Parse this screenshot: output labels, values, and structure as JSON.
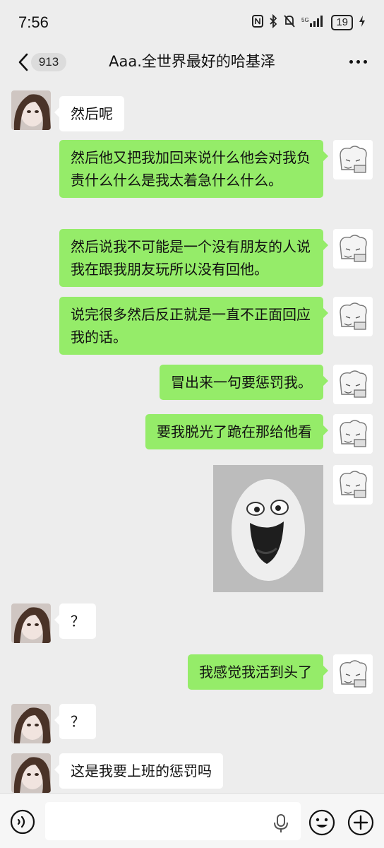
{
  "status": {
    "time": "7:56",
    "battery": "19",
    "network": "5G"
  },
  "nav": {
    "unread_count": "913",
    "title": "Aaa.全世界最好的哈基泽"
  },
  "messages": [
    {
      "side": "in",
      "text": "然后呢"
    },
    {
      "side": "out",
      "text": "然后他又把我加回来说什么他会对我负责什么什么是我太着急什么什么。"
    },
    {
      "side": "out",
      "text": "然后说我不可能是一个没有朋友的人说我在跟我朋友玩所以没有回他。"
    },
    {
      "side": "out",
      "text": "说完很多然后反正就是一直不正面回应我的话。"
    },
    {
      "side": "out",
      "text": "冒出来一句要惩罚我。"
    },
    {
      "side": "out",
      "text": "要我脱光了跪在那给他看"
    },
    {
      "side": "out",
      "type": "sticker",
      "sticker": "smiling-egg-face-sticker"
    },
    {
      "side": "in",
      "text": "？"
    },
    {
      "side": "out",
      "text": "我感觉我活到头了"
    },
    {
      "side": "in",
      "text": "？"
    },
    {
      "side": "in",
      "text": "这是我要上班的惩罚吗"
    }
  ],
  "input": {
    "placeholder": ""
  },
  "icons": {
    "back": "chevron-left-icon",
    "more": "more-dots-icon",
    "voice": "voice-icon",
    "mic": "microphone-icon",
    "emoji": "emoji-icon",
    "plus": "plus-icon"
  },
  "colors": {
    "background": "#ededed",
    "outgoing_bubble": "#95ec69",
    "incoming_bubble": "#ffffff"
  }
}
